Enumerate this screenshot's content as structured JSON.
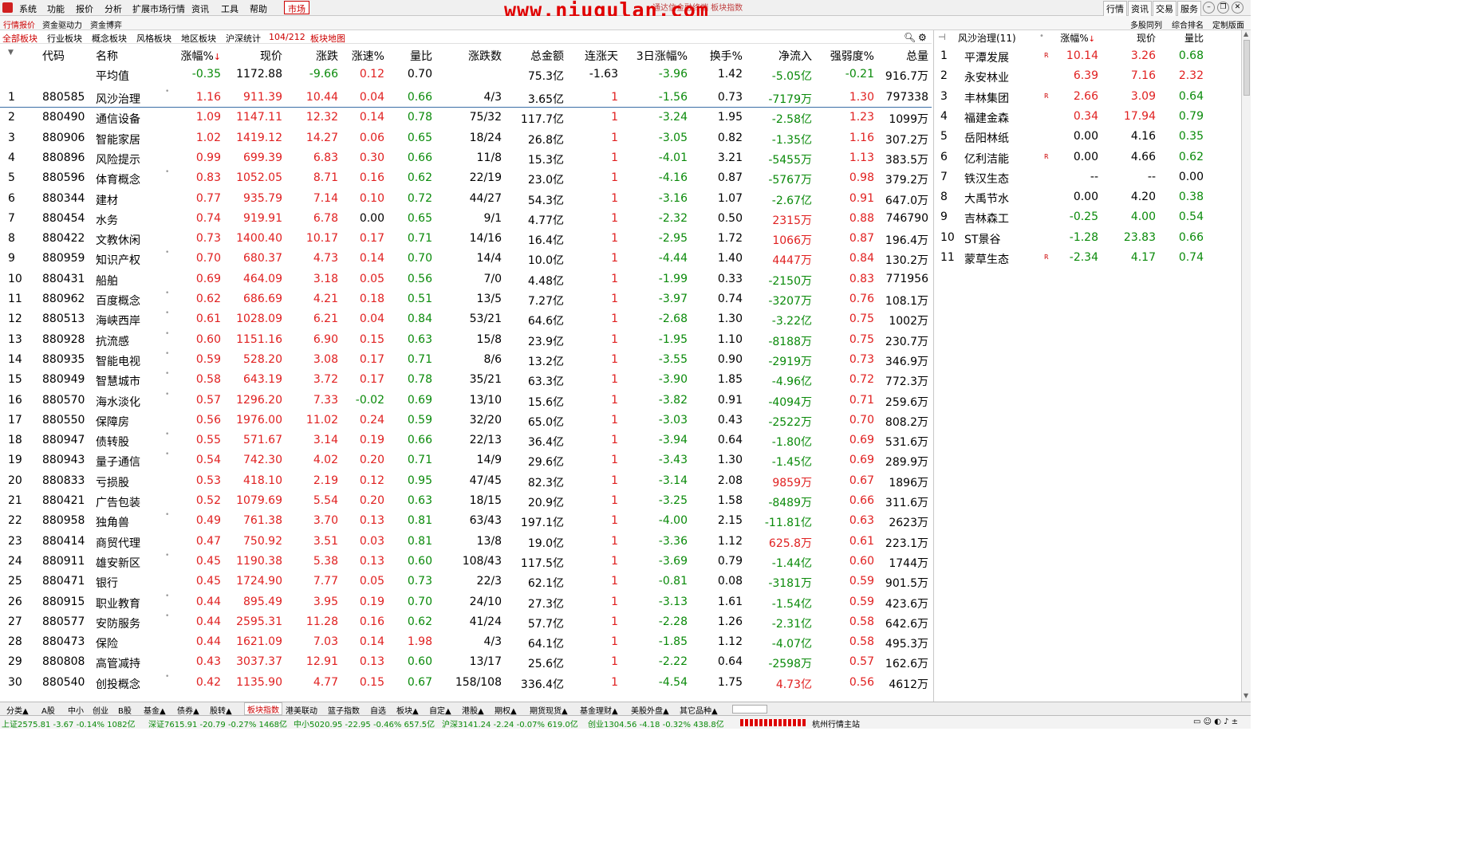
{
  "menubar": {
    "items": [
      "系统",
      "功能",
      "报价",
      "分析",
      "扩展市场行情",
      "资讯",
      "工具",
      "帮助"
    ],
    "market_tab": "市场",
    "watermark": "www.niugulan.com",
    "title_fragment": "通达信金融终端  板块指数",
    "right_buttons": [
      "行情",
      "资讯",
      "交易",
      "服务"
    ]
  },
  "tabrow": {
    "items": [
      "行情报价",
      "资金驱动力",
      "资金博弈"
    ],
    "right_items": [
      "多股同列",
      "综合排名",
      "定制版面"
    ]
  },
  "boardtabs": {
    "items": [
      "全部板块",
      "行业板块",
      "概念板块",
      "风格板块",
      "地区板块",
      "沪深统计"
    ],
    "count": "104/212",
    "map": "板块地图"
  },
  "table": {
    "headers": [
      "代码",
      "名称",
      "涨幅%",
      "现价",
      "涨跌",
      "涨速%",
      "量比",
      "涨跌数",
      "总金额",
      "连涨天",
      "3日涨幅%",
      "换手%",
      "净流入",
      "强弱度%",
      "总量"
    ],
    "avg": {
      "label": "平均值",
      "chg": "-0.35",
      "price": "1172.88",
      "diff": "-9.66",
      "speed": "0.12",
      "vr": "0.70",
      "amt": "75.3亿",
      "days": "-1.63",
      "d3": "-3.96",
      "turn": "1.42",
      "flow": "-5.05亿",
      "str": "-0.21",
      "vol": "916.7万"
    },
    "rows": [
      [
        "1",
        "880585",
        "风沙治理",
        "1.16",
        "911.39",
        "10.44",
        "0.04",
        "0.66",
        "4/3",
        "3.65亿",
        "1",
        "-1.56",
        "0.73",
        "-7179万",
        "1.30",
        "797338"
      ],
      [
        "2",
        "880490",
        "通信设备",
        "1.09",
        "1147.11",
        "12.32",
        "0.14",
        "0.78",
        "75/32",
        "117.7亿",
        "1",
        "-3.24",
        "1.95",
        "-2.58亿",
        "1.23",
        "1099万"
      ],
      [
        "3",
        "880906",
        "智能家居",
        "1.02",
        "1419.12",
        "14.27",
        "0.06",
        "0.65",
        "18/24",
        "26.8亿",
        "1",
        "-3.05",
        "0.82",
        "-1.35亿",
        "1.16",
        "307.2万"
      ],
      [
        "4",
        "880896",
        "风险提示",
        "0.99",
        "699.39",
        "6.83",
        "0.30",
        "0.66",
        "11/8",
        "15.3亿",
        "1",
        "-4.01",
        "3.21",
        "-5455万",
        "1.13",
        "383.5万"
      ],
      [
        "5",
        "880596",
        "体育概念",
        "0.83",
        "1052.05",
        "8.71",
        "0.16",
        "0.62",
        "22/19",
        "23.0亿",
        "1",
        "-4.16",
        "0.87",
        "-5767万",
        "0.98",
        "379.2万"
      ],
      [
        "6",
        "880344",
        "建材",
        "0.77",
        "935.79",
        "7.14",
        "0.10",
        "0.72",
        "44/27",
        "54.3亿",
        "1",
        "-3.16",
        "1.07",
        "-2.67亿",
        "0.91",
        "647.0万"
      ],
      [
        "7",
        "880454",
        "水务",
        "0.74",
        "919.91",
        "6.78",
        "0.00",
        "0.65",
        "9/1",
        "4.77亿",
        "1",
        "-2.32",
        "0.50",
        "2315万",
        "0.88",
        "746790"
      ],
      [
        "8",
        "880422",
        "文教休闲",
        "0.73",
        "1400.40",
        "10.17",
        "0.17",
        "0.71",
        "14/16",
        "16.4亿",
        "1",
        "-2.95",
        "1.72",
        "1066万",
        "0.87",
        "196.4万"
      ],
      [
        "9",
        "880959",
        "知识产权",
        "0.70",
        "680.37",
        "4.73",
        "0.14",
        "0.70",
        "14/4",
        "10.0亿",
        "1",
        "-4.44",
        "1.40",
        "4447万",
        "0.84",
        "130.2万"
      ],
      [
        "10",
        "880431",
        "船舶",
        "0.69",
        "464.09",
        "3.18",
        "0.05",
        "0.56",
        "7/0",
        "4.48亿",
        "1",
        "-1.99",
        "0.33",
        "-2150万",
        "0.83",
        "771956"
      ],
      [
        "11",
        "880962",
        "百度概念",
        "0.62",
        "686.69",
        "4.21",
        "0.18",
        "0.51",
        "13/5",
        "7.27亿",
        "1",
        "-3.97",
        "0.74",
        "-3207万",
        "0.76",
        "108.1万"
      ],
      [
        "12",
        "880513",
        "海峡西岸",
        "0.61",
        "1028.09",
        "6.21",
        "0.04",
        "0.84",
        "53/21",
        "64.6亿",
        "1",
        "-2.68",
        "1.30",
        "-3.22亿",
        "0.75",
        "1002万"
      ],
      [
        "13",
        "880928",
        "抗流感",
        "0.60",
        "1151.16",
        "6.90",
        "0.15",
        "0.63",
        "15/8",
        "23.9亿",
        "1",
        "-1.95",
        "1.10",
        "-8188万",
        "0.75",
        "230.7万"
      ],
      [
        "14",
        "880935",
        "智能电视",
        "0.59",
        "528.20",
        "3.08",
        "0.17",
        "0.71",
        "8/6",
        "13.2亿",
        "1",
        "-3.55",
        "0.90",
        "-2919万",
        "0.73",
        "346.9万"
      ],
      [
        "15",
        "880949",
        "智慧城市",
        "0.58",
        "643.19",
        "3.72",
        "0.17",
        "0.78",
        "35/21",
        "63.3亿",
        "1",
        "-3.90",
        "1.85",
        "-4.96亿",
        "0.72",
        "772.3万"
      ],
      [
        "16",
        "880570",
        "海水淡化",
        "0.57",
        "1296.20",
        "7.33",
        "-0.02",
        "0.69",
        "13/10",
        "15.6亿",
        "1",
        "-3.82",
        "0.91",
        "-4094万",
        "0.71",
        "259.6万"
      ],
      [
        "17",
        "880550",
        "保障房",
        "0.56",
        "1976.00",
        "11.02",
        "0.24",
        "0.59",
        "32/20",
        "65.0亿",
        "1",
        "-3.03",
        "0.43",
        "-2522万",
        "0.70",
        "808.2万"
      ],
      [
        "18",
        "880947",
        "债转股",
        "0.55",
        "571.67",
        "3.14",
        "0.19",
        "0.66",
        "22/13",
        "36.4亿",
        "1",
        "-3.94",
        "0.64",
        "-1.80亿",
        "0.69",
        "531.6万"
      ],
      [
        "19",
        "880943",
        "量子通信",
        "0.54",
        "742.30",
        "4.02",
        "0.20",
        "0.71",
        "14/9",
        "29.6亿",
        "1",
        "-3.43",
        "1.30",
        "-1.45亿",
        "0.69",
        "289.9万"
      ],
      [
        "20",
        "880833",
        "亏损股",
        "0.53",
        "418.10",
        "2.19",
        "0.12",
        "0.95",
        "47/45",
        "82.3亿",
        "1",
        "-3.14",
        "2.08",
        "9859万",
        "0.67",
        "1896万"
      ],
      [
        "21",
        "880421",
        "广告包装",
        "0.52",
        "1079.69",
        "5.54",
        "0.20",
        "0.63",
        "18/15",
        "20.9亿",
        "1",
        "-3.25",
        "1.58",
        "-8489万",
        "0.66",
        "311.6万"
      ],
      [
        "22",
        "880958",
        "独角兽",
        "0.49",
        "761.38",
        "3.70",
        "0.13",
        "0.81",
        "63/43",
        "197.1亿",
        "1",
        "-4.00",
        "2.15",
        "-11.81亿",
        "0.63",
        "2623万"
      ],
      [
        "23",
        "880414",
        "商贸代理",
        "0.47",
        "750.92",
        "3.51",
        "0.03",
        "0.81",
        "13/8",
        "19.0亿",
        "1",
        "-3.36",
        "1.12",
        "625.8万",
        "0.61",
        "223.1万"
      ],
      [
        "24",
        "880911",
        "雄安新区",
        "0.45",
        "1190.38",
        "5.38",
        "0.13",
        "0.60",
        "108/43",
        "117.5亿",
        "1",
        "-3.69",
        "0.79",
        "-1.44亿",
        "0.60",
        "1744万"
      ],
      [
        "25",
        "880471",
        "银行",
        "0.45",
        "1724.90",
        "7.77",
        "0.05",
        "0.73",
        "22/3",
        "62.1亿",
        "1",
        "-0.81",
        "0.08",
        "-3181万",
        "0.59",
        "901.5万"
      ],
      [
        "26",
        "880915",
        "职业教育",
        "0.44",
        "895.49",
        "3.95",
        "0.19",
        "0.70",
        "24/10",
        "27.3亿",
        "1",
        "-3.13",
        "1.61",
        "-1.54亿",
        "0.59",
        "423.6万"
      ],
      [
        "27",
        "880577",
        "安防服务",
        "0.44",
        "2595.31",
        "11.28",
        "0.16",
        "0.62",
        "41/24",
        "57.7亿",
        "1",
        "-2.28",
        "1.26",
        "-2.31亿",
        "0.58",
        "642.6万"
      ],
      [
        "28",
        "880473",
        "保险",
        "0.44",
        "1621.09",
        "7.03",
        "0.14",
        "1.98",
        "4/3",
        "64.1亿",
        "1",
        "-1.85",
        "1.12",
        "-4.07亿",
        "0.58",
        "495.3万"
      ],
      [
        "29",
        "880808",
        "高管减持",
        "0.43",
        "3037.37",
        "12.91",
        "0.13",
        "0.60",
        "13/17",
        "25.6亿",
        "1",
        "-2.22",
        "0.64",
        "-2598万",
        "0.57",
        "162.6万"
      ],
      [
        "30",
        "880540",
        "创投概念",
        "0.42",
        "1135.90",
        "4.77",
        "0.15",
        "0.67",
        "158/108",
        "336.4亿",
        "1",
        "-4.54",
        "1.75",
        "4.73亿",
        "0.56",
        "4612万"
      ]
    ]
  },
  "rightpanel": {
    "title": "风沙治理(11)",
    "headers": [
      "涨幅%",
      "现价",
      "量比"
    ],
    "rows": [
      [
        "1",
        "平潭发展",
        "R",
        "10.14",
        "3.26",
        "0.68"
      ],
      [
        "2",
        "永安林业",
        "",
        "6.39",
        "7.16",
        "2.32"
      ],
      [
        "3",
        "丰林集团",
        "R",
        "2.66",
        "3.09",
        "0.64"
      ],
      [
        "4",
        "福建金森",
        "",
        "0.34",
        "17.94",
        "0.79"
      ],
      [
        "5",
        "岳阳林纸",
        "",
        "0.00",
        "4.16",
        "0.35"
      ],
      [
        "6",
        "亿利洁能",
        "R",
        "0.00",
        "4.66",
        "0.62"
      ],
      [
        "7",
        "铁汉生态",
        "",
        "--",
        "--",
        "0.00"
      ],
      [
        "8",
        "大禹节水",
        "",
        "0.00",
        "4.20",
        "0.38"
      ],
      [
        "9",
        "吉林森工",
        "",
        "-0.25",
        "4.00",
        "0.54"
      ],
      [
        "10",
        "ST景谷",
        "",
        "-1.28",
        "23.83",
        "0.66"
      ],
      [
        "11",
        "蒙草生态",
        "R",
        "-2.34",
        "4.17",
        "0.74"
      ]
    ]
  },
  "bottomtabs": [
    "分类▲",
    "A股",
    "中小",
    "创业",
    "B股",
    "基金▲",
    "债券▲",
    "股转▲",
    "板块指数",
    "港美联动",
    "篮子指数",
    "自选",
    "板块▲",
    "自定▲",
    "港股▲",
    "期权▲",
    "期货现货▲",
    "基金理财▲",
    "美股外盘▲",
    "其它品种▲"
  ],
  "statusbar": {
    "sh": "上证2575.81  -3.67  -0.14%  1082亿",
    "sz": "深证7615.91  -20.79  -0.27%  1468亿",
    "zx": "中小5020.95  -22.95  -0.46%  657.5亿",
    "hs": "沪深3141.24  -2.24  -0.07%  619.0亿",
    "cy": "创业1304.56  -4.18  -0.32%  438.8亿",
    "server": "杭州行情主站"
  },
  "colors": {
    "up": "#e02020",
    "down": "#0a8a0a",
    "accent": "#c00000"
  }
}
